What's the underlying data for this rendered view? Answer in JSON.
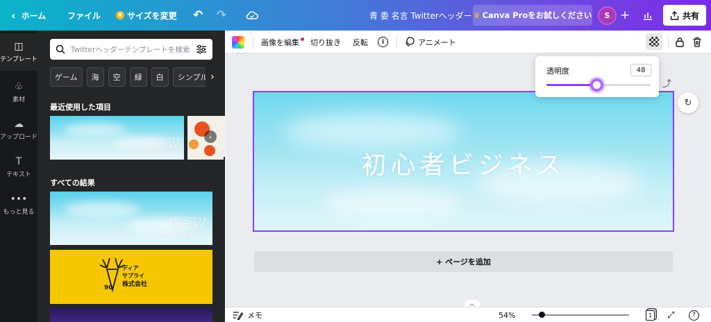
{
  "topbar": {
    "back_icon": "chevron-left-icon",
    "home": "ホーム",
    "file": "ファイル",
    "resize": "サイズを変更",
    "doc_title": "青 委 名言 Twitterヘッダー",
    "pro_trial": "Canva Proをお試しください",
    "avatar_initial": "S",
    "share": "共有"
  },
  "rail": {
    "items": [
      {
        "label": "テンプレート",
        "icon": "template-icon"
      },
      {
        "label": "素材",
        "icon": "elements-icon"
      },
      {
        "label": "アップロード",
        "icon": "upload-icon"
      },
      {
        "label": "テキスト",
        "icon": "text-icon"
      },
      {
        "label": "もっと見る",
        "icon": "more-icon"
      }
    ]
  },
  "panel": {
    "search_placeholder": "Twitterヘッダーテンプレートを検索",
    "chips": [
      "ゲーム",
      "海",
      "空",
      "緑",
      "白",
      "シンプル"
    ],
    "recent_title": "最近使用した項目",
    "all_results_title": "すべての結果",
    "sky_line1": "太陽の下で生きる",
    "sky_line2": "海で泳ぐ",
    "sky_line3": "自然の空気を吸い込む",
    "logo_line1": "ディア",
    "logo_line2": "サプライ",
    "logo_line3": "株式会社",
    "logo_number": "90"
  },
  "context_toolbar": {
    "edit_image": "画像を編集",
    "crop": "切り抜き",
    "flip": "反転",
    "animate": "アニメート"
  },
  "transparency": {
    "label": "透明度",
    "value": "48",
    "fraction": 0.48
  },
  "canvas": {
    "design_title": "初心者ビジネス",
    "add_page": "+ ページを追加"
  },
  "bottombar": {
    "notes": "メモ",
    "zoom": "54%",
    "zoom_fraction": 0.1,
    "page_count": "1",
    "help": "?"
  },
  "colors": {
    "accent": "#8b3dff",
    "panel_bg": "#252627",
    "rail_bg": "#18191b"
  }
}
